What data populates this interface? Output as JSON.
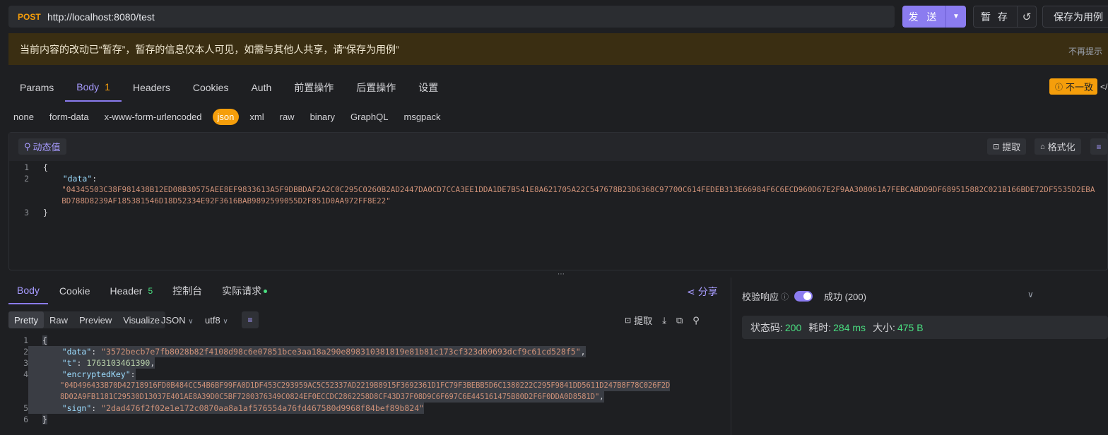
{
  "request": {
    "method": "POST",
    "url": "http://localhost:8080/test",
    "send_label": "发 送",
    "save_label": "暂 存",
    "save_as_label": "保存为用例"
  },
  "notice": {
    "text": "当前内容的改动已“暂存”，暂存的信息仅本人可见，如需与其他人共享，请“保存为用例”",
    "dismiss": "不再提示"
  },
  "req_tabs": [
    {
      "label": "Params"
    },
    {
      "label": "Body",
      "count": "1"
    },
    {
      "label": "Headers"
    },
    {
      "label": "Cookies"
    },
    {
      "label": "Auth"
    },
    {
      "label": "前置操作"
    },
    {
      "label": "后置操作"
    },
    {
      "label": "设置"
    }
  ],
  "inconsistent_label": "不一致",
  "body_types": [
    "none",
    "form-data",
    "x-www-form-urlencoded",
    "json",
    "xml",
    "raw",
    "binary",
    "GraphQL",
    "msgpack"
  ],
  "editor": {
    "dynamic_label": "动态值",
    "extract_label": "提取",
    "format_label": "格式化",
    "lines": [
      "1",
      "2",
      "",
      "3"
    ],
    "key": "\"data\"",
    "value_line1": "\"04345503C38F981438B12ED08B30575AEE8EF9833613A5F9DBBDAF2A2C0C295C0260B2AD2447DA0CD7CCA3EE1DDA1DE7B541E8A621705A22C547678B23D6368C97700C614FEDEB313E66984F6C6ECD960D67E2F9AA308061A7FEBCABDD9DF689515882C021B166BDE72DF5535D2EBA",
    "value_line2": "BD788D8239AF185381546D18D52334E92F3616BAB9892599055D2F851D0AA972FF8E22\""
  },
  "resp_tabs": [
    {
      "label": "Body"
    },
    {
      "label": "Cookie"
    },
    {
      "label": "Header",
      "count": "5"
    },
    {
      "label": "控制台"
    },
    {
      "label": "实际请求"
    }
  ],
  "share_label": "分享",
  "view_tabs": [
    "Pretty",
    "Raw",
    "Preview",
    "Visualize"
  ],
  "format_select": "JSON",
  "encoding_select": "utf8",
  "resp_extract_label": "提取",
  "response": {
    "data_key": "\"data\"",
    "data_val": "\"3572becb7e7fb8028b82f4108d98c6e07851bce3aa18a290e898310381819e81b81c173cf323d69693dcf9c61cd528f5\"",
    "t_key": "\"t\"",
    "t_val": "1763103461390",
    "ek_key": "\"encryptedKey\"",
    "ek_val1": "\"04D496433B70D42718916FD0B484CC54B6BF99FA0D1DF453C293959AC5C52337AD2219B8915F3692361D1FC79F3BEBB5D6C1380222C295F9841DD5611D247B8F78C026F2D",
    "ek_val2": "8D02A9FB1181C29530D13037E401AE8A39D0C5BF7280376349C0824EF0ECCDC2862258D8CF43D37F08D9C6F697C6E445161475B80D2F6F0DDA0D8581D\"",
    "sign_key": "\"sign\"",
    "sign_val": "\"2dad476f2f02e1e172c0870aa8a1af576554a76fd467580d9968f84bef89b824\""
  },
  "verify": {
    "label": "校验响应",
    "status_select": "成功 (200)"
  },
  "status": {
    "code_label": "状态码:",
    "code": "200",
    "time_label": "耗时:",
    "time": "284 ms",
    "size_label": "大小:",
    "size": "475 B"
  }
}
